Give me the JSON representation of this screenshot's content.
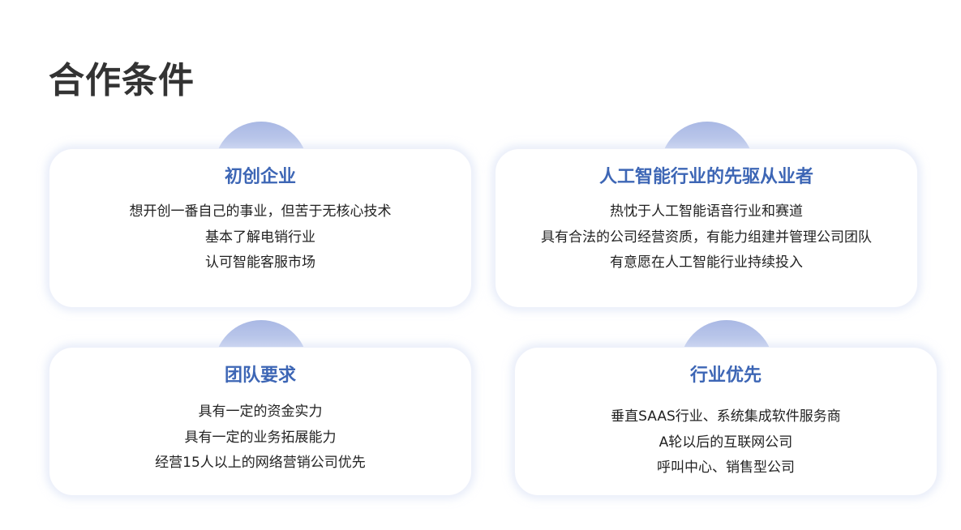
{
  "page_title": "合作条件",
  "cards": [
    {
      "title": "初创企业",
      "lines": [
        "想开创一番自己的事业，但苦于无核心技术",
        "基本了解电销行业",
        "认可智能客服市场"
      ]
    },
    {
      "title": "人工智能行业的先驱从业者",
      "lines": [
        "热忱于人工智能语音行业和赛道",
        "具有合法的公司经营资质，有能力组建并管理公司团队",
        "有意愿在人工智能行业持续投入"
      ]
    },
    {
      "title": "团队要求",
      "lines": [
        "具有一定的资金实力",
        "具有一定的业务拓展能力",
        "经营15人以上的网络营销公司优先"
      ]
    },
    {
      "title": "行业优先",
      "lines": [
        "垂直SAAS行业、系统集成软件服务商",
        "A轮以后的互联网公司",
        "呼叫中心、销售型公司"
      ]
    }
  ]
}
